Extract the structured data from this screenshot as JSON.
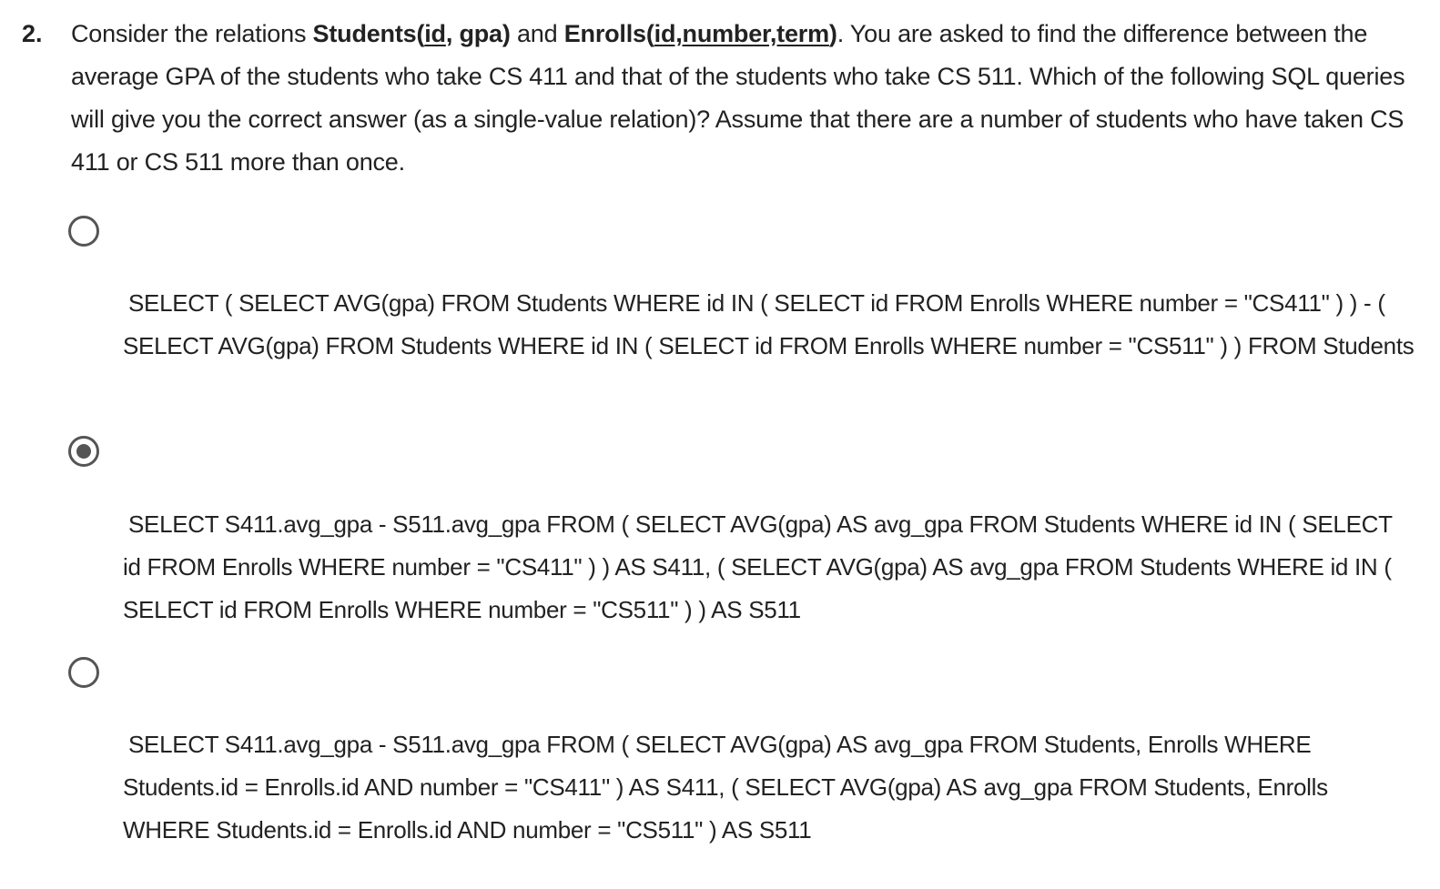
{
  "question": {
    "number": "2.",
    "intro": "Consider the relations ",
    "students_rel_name": "Students(",
    "students_key": "id",
    "students_rest": ", gpa)",
    "and_text": " and ",
    "enrolls_rel_name": "Enrolls(",
    "enrolls_attrs": "id,number,term",
    "enrolls_close": ")",
    "body": ". You are asked to find the difference between the average GPA of the students who take CS 411 and that of the students who take CS 511. Which of the following SQL queries will give you the correct answer (as a single-value relation)? Assume that there are a number of students who have taken CS 411 or CS 511 more than once."
  },
  "options": [
    {
      "selected": false,
      "text": "SELECT ( SELECT AVG(gpa) FROM Students WHERE id IN ( SELECT id FROM Enrolls WHERE number = \"CS411\" ) ) - ( SELECT AVG(gpa) FROM Students WHERE id IN ( SELECT id FROM Enrolls WHERE number = \"CS511\" ) ) FROM Students"
    },
    {
      "selected": true,
      "text": "SELECT S411.avg_gpa - S511.avg_gpa FROM ( SELECT AVG(gpa) AS avg_gpa FROM Students WHERE id IN ( SELECT id FROM Enrolls WHERE number = \"CS411\" ) ) AS S411, ( SELECT AVG(gpa) AS avg_gpa FROM Students WHERE id IN ( SELECT id FROM Enrolls WHERE number = \"CS511\" ) ) AS S511"
    },
    {
      "selected": false,
      "text": "SELECT S411.avg_gpa - S511.avg_gpa FROM ( SELECT AVG(gpa) AS avg_gpa FROM Students, Enrolls WHERE Students.id = Enrolls.id AND number = \"CS411\" ) AS S411, ( SELECT AVG(gpa) AS avg_gpa FROM Students, Enrolls WHERE Students.id = Enrolls.id AND number = \"CS511\" ) AS S511"
    }
  ],
  "colors": {
    "text": "#222222",
    "radio_border": "#555555",
    "radio_fill": "#555555"
  }
}
